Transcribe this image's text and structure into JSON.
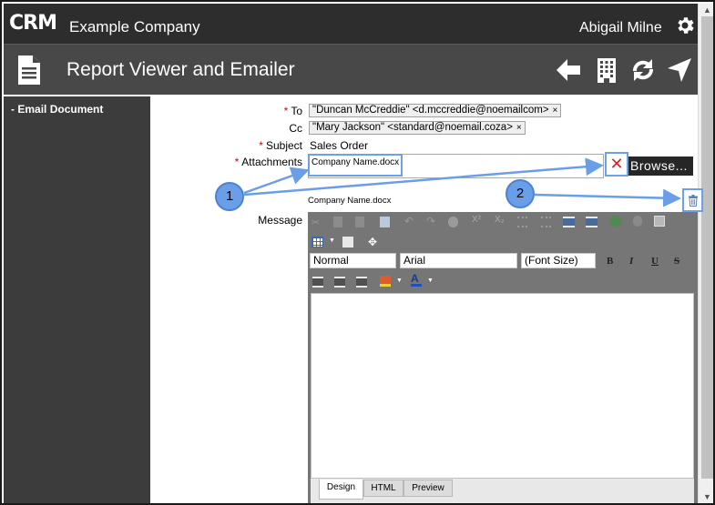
{
  "header": {
    "logo": "CRM",
    "company": "Example Company",
    "user": "Abigail Milne"
  },
  "titlebar": {
    "title": "Report Viewer and Emailer"
  },
  "sidebar": {
    "items": [
      {
        "label": "Email Document"
      }
    ]
  },
  "form": {
    "required_mark": "*",
    "to_label": "To",
    "cc_label": "Cc",
    "subject_label": "Subject",
    "attachments_label": "Attachments",
    "message_label": "Message",
    "to_tag": "\"Duncan McCreddie\" <d.mccreddie@noemailcom>",
    "cc_tag": "\"Mary Jackson\" <standard@noemail.coza>",
    "tag_remove": "×",
    "subject_value": "Sales Order",
    "attachment_input_value": "Company Name.docx",
    "clear_glyph": "✕",
    "browse_label": "Browse...",
    "attached_file": "Company Name.docx"
  },
  "editor": {
    "paragraph_format": "Normal",
    "font_name": "Arial",
    "font_size": "(Font Size)",
    "bold": "B",
    "italic": "I",
    "underline": "U",
    "strike": "S",
    "text_color": "A",
    "tabs": [
      "Design",
      "HTML",
      "Preview"
    ]
  },
  "annotations": {
    "callout_1": "1",
    "callout_2": "2"
  },
  "colors": {
    "topbar": "#2d2d2d",
    "titlebar": "#484848",
    "sidebar": "#3c3c3c",
    "required": "#d40000",
    "highlight": "#6ea0e8",
    "clear_x": "#e02020"
  }
}
